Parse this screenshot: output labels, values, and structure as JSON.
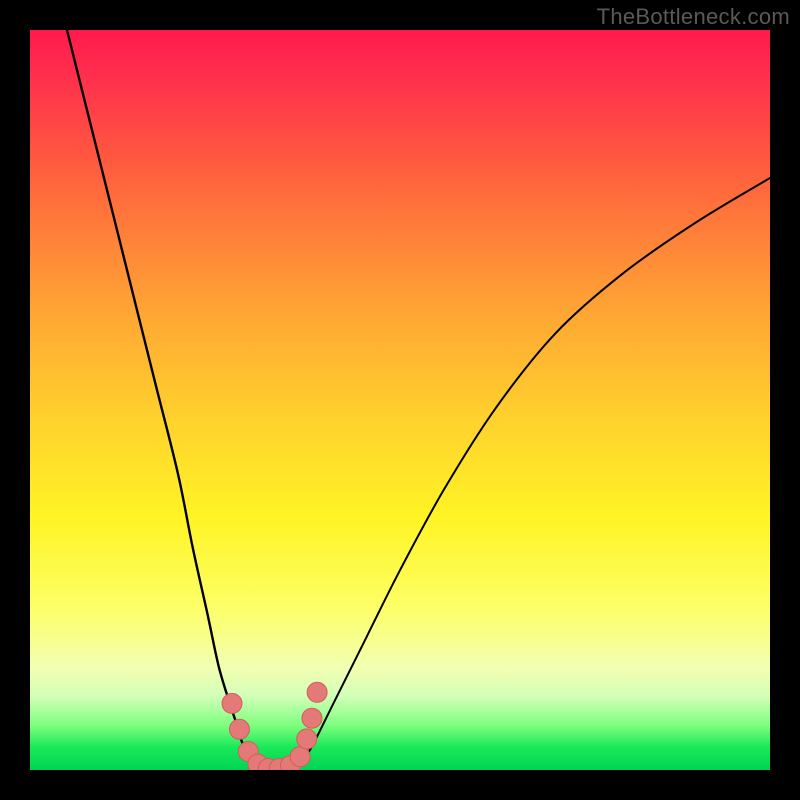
{
  "watermark": "TheBottleneck.com",
  "colors": {
    "frame": "#000000",
    "curve": "#000000",
    "marker_fill": "#e47a78",
    "marker_stroke": "#d55c5a",
    "gradient_top": "#ff1a4d",
    "gradient_bottom": "#00d453"
  },
  "chart_data": {
    "type": "line",
    "title": "",
    "xlabel": "",
    "ylabel": "",
    "xlim": [
      0,
      100
    ],
    "ylim": [
      0,
      100
    ],
    "series": [
      {
        "name": "left-branch",
        "x": [
          5,
          8,
          11,
          14,
          17,
          20,
          22,
          24,
          25.5,
          27,
          28,
          29,
          31.5
        ],
        "y": [
          100,
          88,
          76,
          64,
          52,
          40,
          30,
          21,
          14,
          9,
          6,
          3,
          0
        ]
      },
      {
        "name": "right-branch",
        "x": [
          36,
          38,
          41,
          45,
          50,
          56,
          63,
          71,
          80,
          90,
          100
        ],
        "y": [
          0,
          3,
          9,
          17,
          27,
          38,
          49,
          59,
          67,
          74,
          80
        ]
      },
      {
        "name": "markers",
        "x": [
          27.3,
          28.3,
          29.5,
          30.8,
          32.2,
          33.7,
          35.2,
          36.5,
          37.4,
          38.1,
          38.8
        ],
        "y": [
          9.0,
          5.5,
          2.5,
          0.8,
          0.2,
          0.2,
          0.6,
          1.8,
          4.2,
          7.0,
          10.5
        ]
      }
    ]
  }
}
